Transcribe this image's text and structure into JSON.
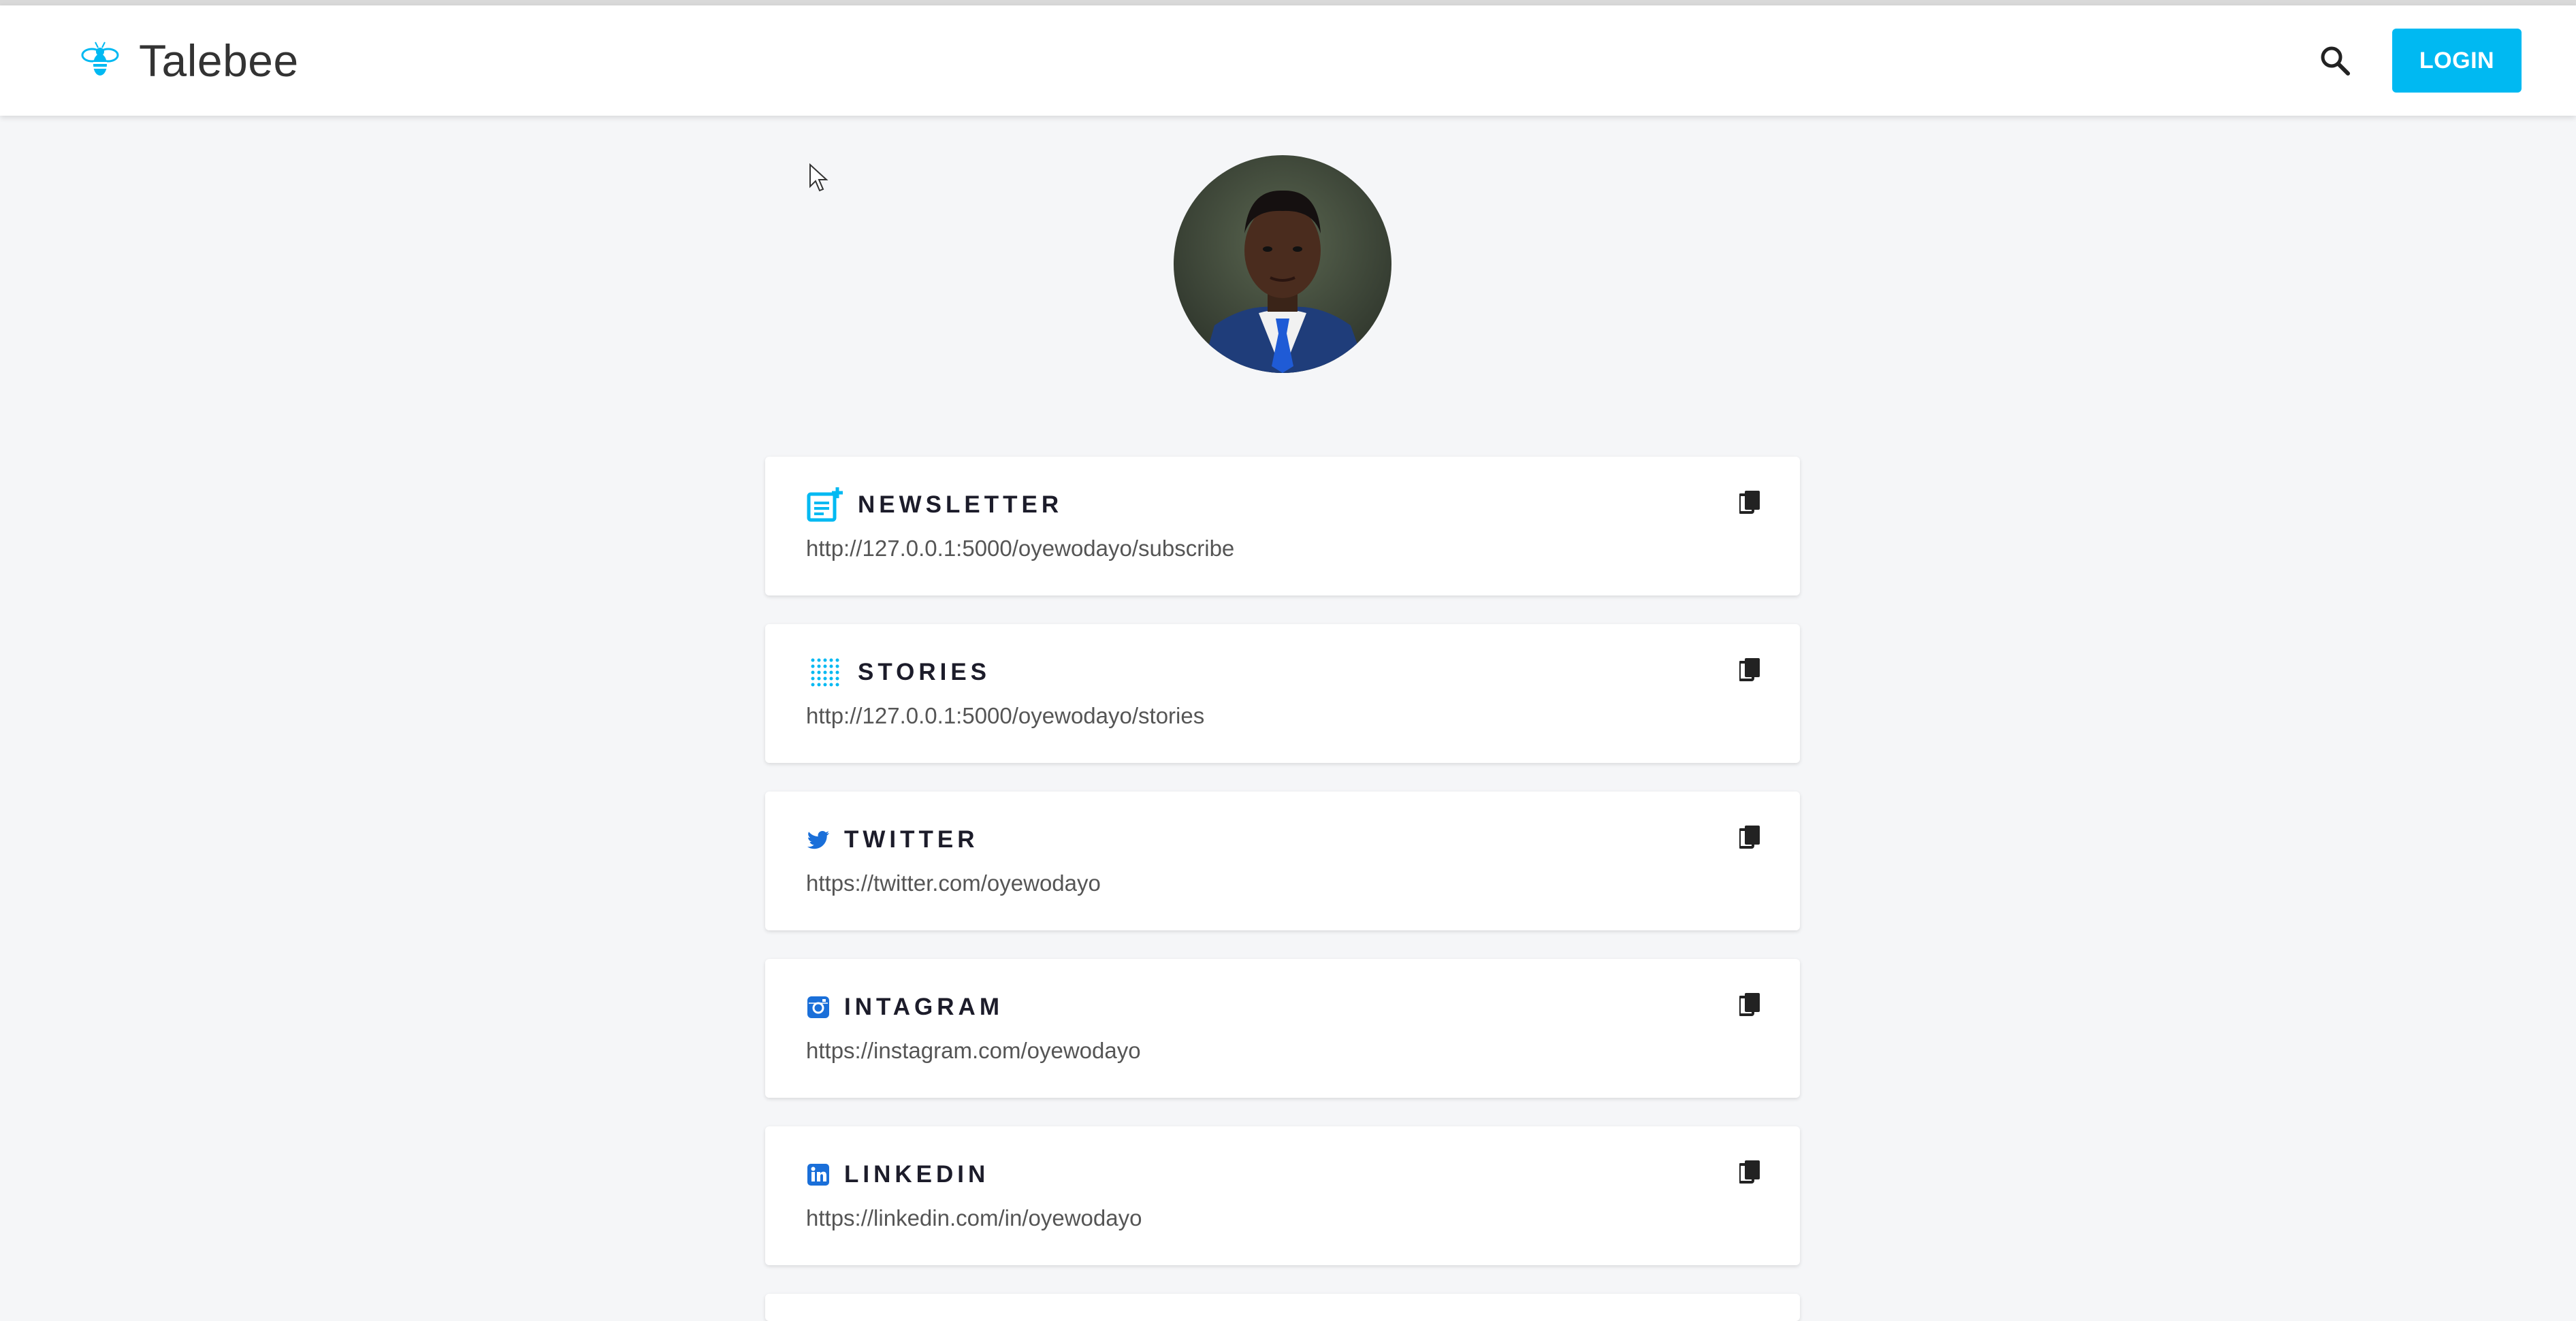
{
  "header": {
    "brand": "Talebee",
    "login_label": "LOGIN"
  },
  "colors": {
    "accent": "#00b9f2",
    "icon_blue": "#1a6fd9",
    "background": "#f5f6f8"
  },
  "links": [
    {
      "title": "NEWSLETTER",
      "url": "http://127.0.0.1:5000/oyewodayo/subscribe",
      "icon": "newsletter-icon"
    },
    {
      "title": "STORIES",
      "url": "http://127.0.0.1:5000/oyewodayo/stories",
      "icon": "stories-icon"
    },
    {
      "title": "TWITTER",
      "url": "https://twitter.com/oyewodayo",
      "icon": "twitter-icon"
    },
    {
      "title": "INTAGRAM",
      "url": "https://instagram.com/oyewodayo",
      "icon": "instagram-icon"
    },
    {
      "title": "LINKEDIN",
      "url": "https://linkedin.com/in/oyewodayo",
      "icon": "linkedin-icon"
    }
  ]
}
